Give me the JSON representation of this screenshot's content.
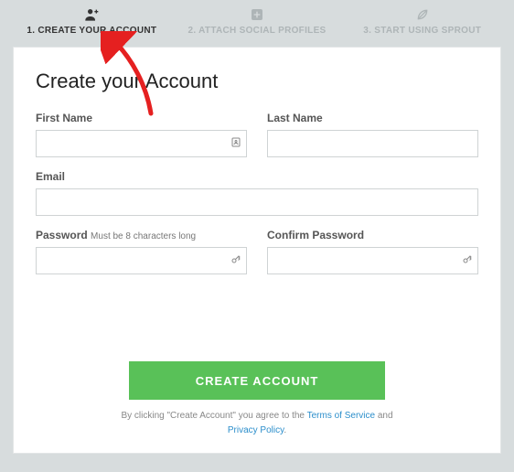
{
  "steps": [
    {
      "label": "1. CREATE YOUR ACCOUNT",
      "icon": "person-plus"
    },
    {
      "label": "2. ATTACH SOCIAL PROFILES",
      "icon": "plus-box"
    },
    {
      "label": "3. START USING SPROUT",
      "icon": "leaf"
    }
  ],
  "heading": "Create your Account",
  "fields": {
    "first_name": {
      "label": "First Name",
      "value": ""
    },
    "last_name": {
      "label": "Last Name",
      "value": ""
    },
    "email": {
      "label": "Email",
      "value": ""
    },
    "password": {
      "label": "Password",
      "hint": "Must be 8 characters long",
      "value": ""
    },
    "confirm_password": {
      "label": "Confirm Password",
      "value": ""
    }
  },
  "button": "CREATE ACCOUNT",
  "fineprint": {
    "prefix": "By clicking \"Create Account\" you agree to the ",
    "tos": "Terms of Service",
    "and": " and ",
    "privacy": "Privacy Policy",
    "suffix": "."
  }
}
